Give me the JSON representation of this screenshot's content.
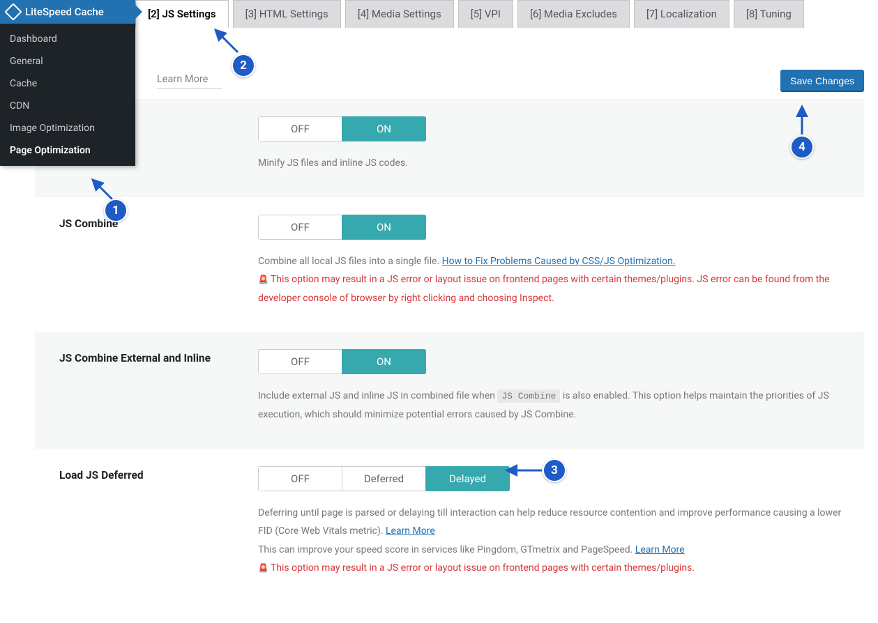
{
  "sidebar": {
    "title": "LiteSpeed Cache",
    "items": [
      {
        "label": "Dashboard"
      },
      {
        "label": "General"
      },
      {
        "label": "Cache"
      },
      {
        "label": "CDN"
      },
      {
        "label": "Image Optimization"
      },
      {
        "label": "Page Optimization",
        "active": true
      }
    ]
  },
  "tabs": [
    {
      "label": "[2] JS Settings",
      "active": true
    },
    {
      "label": "[3] HTML Settings"
    },
    {
      "label": "[4] Media Settings"
    },
    {
      "label": "[5] VPI"
    },
    {
      "label": "[6] Media Excludes"
    },
    {
      "label": "[7] Localization"
    },
    {
      "label": "[8] Tuning"
    }
  ],
  "topbar": {
    "learn_more": "Learn More",
    "save_label": "Save Changes"
  },
  "settings": {
    "minify": {
      "label": "",
      "off": "OFF",
      "on": "ON",
      "desc": "Minify JS files and inline JS codes."
    },
    "combine": {
      "label": "JS Combine",
      "off": "OFF",
      "on": "ON",
      "desc_pre": "Combine all local JS files into a single file. ",
      "desc_link": "How to Fix Problems Caused by CSS/JS Optimization.",
      "warn": "This option may result in a JS error or layout issue on frontend pages with certain themes/plugins. JS error can be found from the developer console of browser by right clicking and choosing Inspect."
    },
    "combine_ext": {
      "label": "JS Combine External and Inline",
      "off": "OFF",
      "on": "ON",
      "desc_pre": "Include external JS and inline JS in combined file when ",
      "code": "JS Combine",
      "desc_post": " is also enabled. This option helps maintain the priorities of JS execution, which should minimize potential errors caused by JS Combine."
    },
    "defer": {
      "label": "Load JS Deferred",
      "off": "OFF",
      "deferred": "Deferred",
      "delayed": "Delayed",
      "desc1_pre": "Deferring until page is parsed or delaying till interaction can help reduce resource contention and improve performance causing a lower FID (Core Web Vitals metric). ",
      "desc1_link": "Learn More",
      "desc2_pre": "This can improve your speed score in services like Pingdom, GTmetrix and PageSpeed. ",
      "desc2_link": "Learn More",
      "warn": "This option may result in a JS error or layout issue on frontend pages with certain themes/plugins."
    }
  },
  "markers": {
    "m1": "1",
    "m2": "2",
    "m3": "3",
    "m4": "4"
  }
}
